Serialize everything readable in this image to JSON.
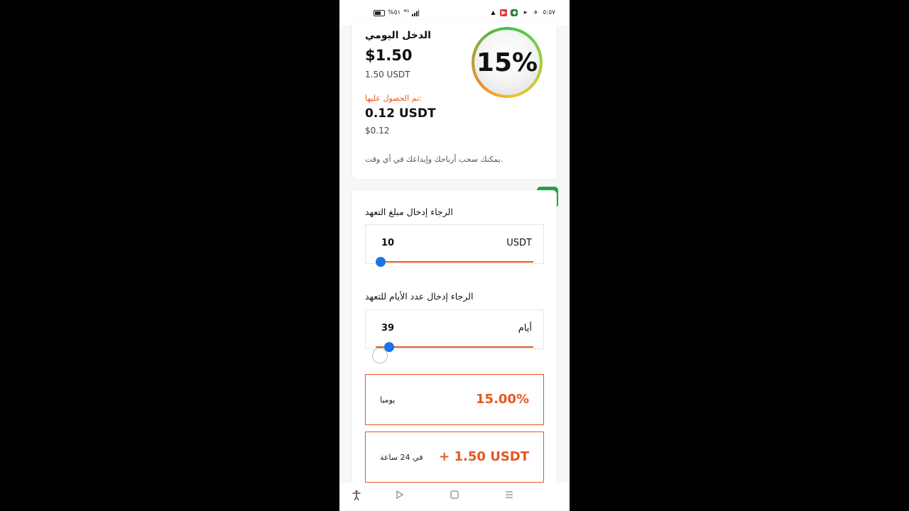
{
  "status_bar": {
    "time": "٥:٥٧",
    "battery_text": "%٥١",
    "signal_text": "⁴ᴳ",
    "icons": [
      "warning-icon",
      "youtube-icon",
      "shield-icon",
      "send-icon",
      "telegram-icon"
    ]
  },
  "income_card": {
    "title": "الدخل اليومي",
    "price_usd": "$1.50",
    "price_usdt": "1.50 USDT",
    "obtained_label": "تم الحصول عليها:",
    "obtained_usdt": "0.12 USDT",
    "obtained_usd": "$0.12",
    "note": "يمكنك سحب أرباحك وإيداعك في أي وقت.",
    "gauge_text": "15%"
  },
  "pledge_form": {
    "amount_label": "الرجاء إدخال مبلغ التعهد",
    "amount_value": "10",
    "amount_unit": "USDT",
    "days_label": "الرجاء إدخال عدد الأيام للتعهد",
    "days_value": "39",
    "days_unit": "أيام"
  },
  "stats": {
    "rate_value": "15.00%",
    "rate_label": "يوميا",
    "earn_value": "+ 1.50 USDT",
    "earn_label": "في 24 ساعة"
  },
  "colors": {
    "accent": "#e8571e",
    "slider_thumb": "#1a73e8",
    "whatsapp": "#25a244"
  },
  "nav": {
    "accessibility_icon": "accessibility-icon",
    "back_icon": "back-icon",
    "home_icon": "home-icon",
    "menu_icon": "menu-icon"
  }
}
